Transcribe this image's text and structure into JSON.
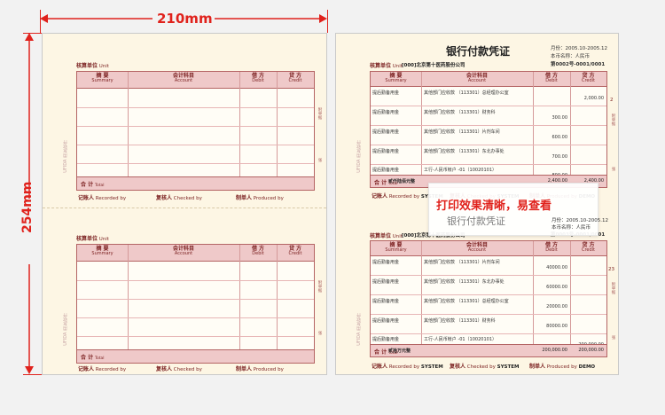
{
  "dimensions": {
    "width_label": "210mm",
    "height_label": "254mm",
    "color": "#e0221c"
  },
  "colors": {
    "accent_red": "#e0221c",
    "form_line": "#b46464",
    "paper": "#fdf6e4",
    "header_fill": "#efc9c9"
  },
  "blank_form": {
    "unit_label": "核算单位",
    "unit_label_en": "Unit",
    "columns": [
      {
        "cn": "摘 要",
        "en": "Summary"
      },
      {
        "cn": "会计科目",
        "en": "Account"
      },
      {
        "cn": "借 方",
        "en": "Debit"
      },
      {
        "cn": "贷 方",
        "en": "Credit"
      }
    ],
    "total_label": "合 计",
    "total_en": "Total",
    "signatures": [
      {
        "cn": "记账人",
        "en": "Recorded by"
      },
      {
        "cn": "复核人",
        "en": "Checked by"
      },
      {
        "cn": "制单人",
        "en": "Produced by"
      }
    ],
    "brand_vertical": "UFIDA 用友软件",
    "side_notes": [
      "附单据",
      "张",
      "本凭证打印"
    ]
  },
  "voucher": {
    "title": "银行付款凭证",
    "period_label": "月份：2005.10-2005.12",
    "currency_label": "本币名称：人民币",
    "top_number": "第0002号-0001/0001",
    "bottom_number": "第0003号-0001/0001",
    "unit_value": "[000]北京第十医药股份公司",
    "top_rows": [
      {
        "summary": "提后勤备用金",
        "account": "其他部门应收款 （113301）总经理办公室",
        "debit": "",
        "credit": "2,000.00"
      },
      {
        "summary": "提后勤备用金",
        "account": "其他部门应收款 （113301）财务科",
        "debit": "300.00",
        "credit": ""
      },
      {
        "summary": "提后勤备用金",
        "account": "其他部门应收款 （113301）片剂车间",
        "debit": "600.00",
        "credit": ""
      },
      {
        "summary": "提后勤备用金",
        "account": "其他部门应收款 （113301）东北办事处",
        "debit": "700.00",
        "credit": ""
      },
      {
        "summary": "提后勤备用金",
        "account": "工行-人民币帐户 -01（10020101）",
        "debit": "800.00",
        "credit": ""
      }
    ],
    "top_total_words": "贰仟陆佰元整",
    "top_total_debit": "2,400.00",
    "top_total_credit": "2,400.00",
    "bottom_rows": [
      {
        "summary": "提后勤备用金",
        "account": "其他部门应收款 （113301）片剂车间",
        "debit": "40000.00",
        "credit": ""
      },
      {
        "summary": "提后勤备用金",
        "account": "其他部门应收款 （113301）东北办事处",
        "debit": "60000.00",
        "credit": ""
      },
      {
        "summary": "提后勤备用金",
        "account": "其他部门应收款 （113301）总经理办公室",
        "debit": "20000.00",
        "credit": ""
      },
      {
        "summary": "提后勤备用金",
        "account": "其他部门应收款 （113301）财务科",
        "debit": "80000.00",
        "credit": ""
      },
      {
        "summary": "提后勤备用金",
        "account": "工行-人民币帐户 -01（10020101）",
        "debit": "",
        "credit": "200,000.00"
      }
    ],
    "bottom_total_words": "贰拾万元整",
    "bottom_total_debit": "200,000.00",
    "bottom_total_credit": "200,000.00",
    "recorder": "SYSTEM",
    "checker": "SYSTEM",
    "producer": "DEMO",
    "side_page_top": "2",
    "side_page_bottom": "23"
  },
  "callout": {
    "headline": "打印效果清晰，易查看",
    "subtitle": "银行付款凭证",
    "period": "月份：2005.10-2005.12",
    "currency": "本币名称：人民币",
    "number": "第0003号-0001/0001"
  }
}
